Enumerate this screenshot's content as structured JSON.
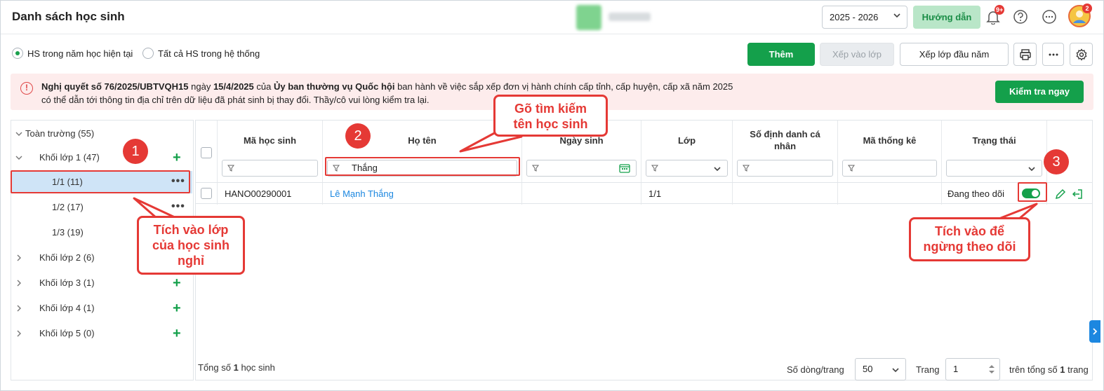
{
  "header": {
    "title": "Danh sách học sinh",
    "year": "2025 - 2026",
    "guide_label": "Hướng dẫn",
    "notif_badge": "9+",
    "avatar_badge": "2"
  },
  "toolbar": {
    "radio_current": "HS trong năm học hiện tại",
    "radio_all": "Tất cả HS trong hệ thống",
    "add_label": "Thêm",
    "assign_label": "Xếp vào lớp",
    "assign_start_label": "Xếp lớp đầu năm"
  },
  "alert": {
    "part1": "Nghị quyết số 76/2025/UBTVQH15",
    "part2": " ngày ",
    "part3": "15/4/2025",
    "part4": " của ",
    "part5": "Ủy ban thường vụ Quốc hội",
    "part6": " ban hành về việc sắp xếp đơn vị hành chính cấp tỉnh, cấp huyện, cấp xã năm 2025 có thể dẫn tới thông tin địa chỉ trên dữ liệu đã phát sinh bị thay đổi. Thầy/cô vui lòng kiểm tra lại.",
    "check_label": "Kiểm tra ngay"
  },
  "tree": {
    "root": "Toàn trường (55)",
    "grade1": "Khối lớp 1 (47)",
    "class11": "1/1 (11)",
    "class12": "1/2 (17)",
    "class13": "1/3 (19)",
    "grade2": "Khối lớp 2 (6)",
    "grade3": "Khối lớp 3 (1)",
    "grade4": "Khối lớp 4 (1)",
    "grade5": "Khối lớp 5 (0)"
  },
  "grid": {
    "columns": {
      "code": "Mã học sinh",
      "name": "Họ tên",
      "dob": "Ngày sinh",
      "class": "Lớp",
      "id_no": "Số định danh cá nhân",
      "stat_code": "Mã thống kê",
      "status": "Trạng thái"
    },
    "name_filter": "Thắng",
    "rows": [
      {
        "code": "HANO00290001",
        "name": "Lê Mạnh Thắng",
        "dob": "",
        "class": "1/1",
        "id_no": "",
        "stat_code": "",
        "status": "Đang theo dõi"
      }
    ]
  },
  "footer": {
    "total_prefix": "Tổng số ",
    "total_count": "1",
    "total_suffix": " học sinh",
    "rows_per_page_label": "Số dòng/trang",
    "rows_per_page": "50",
    "page_label": "Trang",
    "page": "1",
    "pages_prefix": "trên tổng số ",
    "pages_count": "1",
    "pages_suffix": " trang"
  },
  "annotations": {
    "n1": "1",
    "n2": "2",
    "n3": "3",
    "callout1_line1": "Tích vào lớp",
    "callout1_line2": "của học sinh",
    "callout1_line3": "nghỉ",
    "callout2_line1": "Gõ tìm kiếm",
    "callout2_line2": "tên học sinh",
    "callout3_line1": "Tích vào để",
    "callout3_line2": "ngừng theo dõi"
  }
}
